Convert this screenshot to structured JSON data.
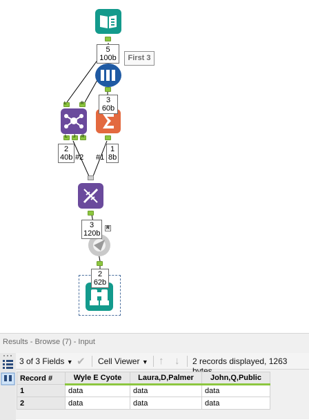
{
  "canvas": {
    "input_badge": "5\n100b",
    "sample_label": "First 3",
    "sample_badge": "3\n60b",
    "join_badge": "2\n40b",
    "join_note": "#2",
    "summarize_badge": "1\n8b",
    "summarize_note": "#1",
    "transpose_badge": "3\n120b",
    "formula_badge": "2\n62b",
    "join_anchor_labels": [
      "L",
      "R",
      "L",
      "J",
      "R"
    ],
    "union_anchor_label": "R"
  },
  "results": {
    "title": "Results - Browse (7) - Input",
    "fields_label": "3 of 3 Fields",
    "viewer_label": "Cell Viewer",
    "status": "2 records displayed, 1263 bytes",
    "columns": [
      "Record #",
      "Wyle E Cyote",
      "Laura,D,Palmer",
      "John,Q,Public"
    ],
    "rows": [
      [
        "1",
        "data",
        "data",
        "data"
      ],
      [
        "2",
        "data",
        "data",
        "data"
      ]
    ]
  },
  "colors": {
    "teal": "#139a8c",
    "blue": "#1f5aa3",
    "purple": "#6a4a9c",
    "orange": "#e3693f",
    "connector_green": "#8cc63f"
  }
}
